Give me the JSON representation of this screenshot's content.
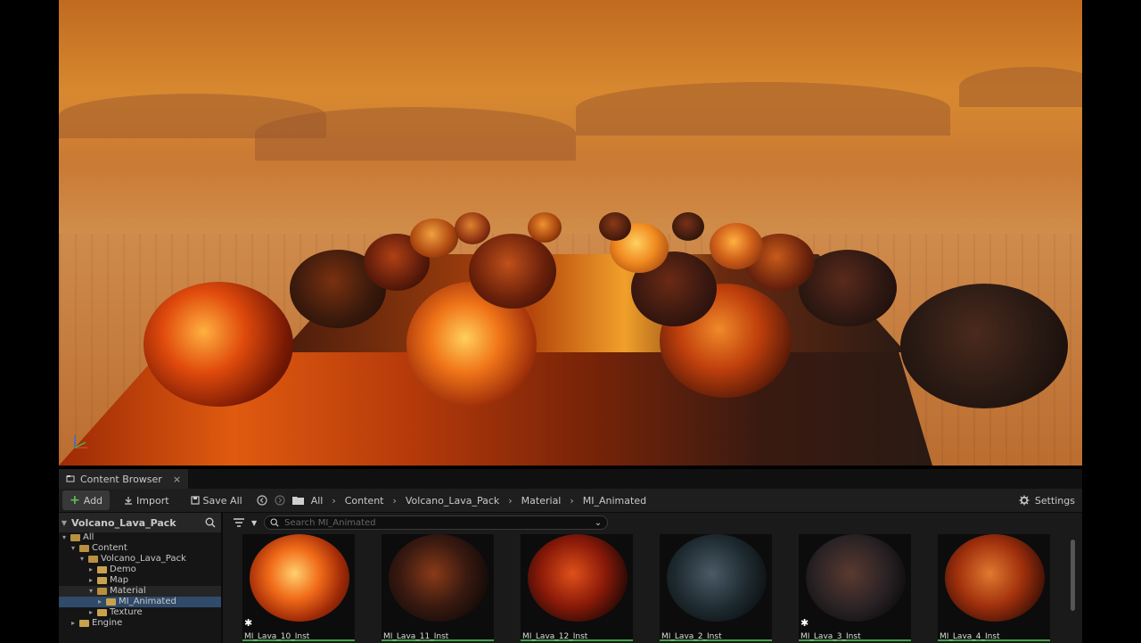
{
  "content_browser": {
    "tab_title": "Content Browser",
    "tab_close": "×",
    "toolbar": {
      "add_label": "Add",
      "import_label": "Import",
      "save_all_label": "Save All",
      "settings_label": "Settings"
    },
    "breadcrumb": [
      "All",
      "Content",
      "Volcano_Lava_Pack",
      "Material",
      "MI_Animated"
    ],
    "tree": {
      "title": "Volcano_Lava_Pack",
      "items": [
        {
          "label": "All",
          "depth": 0,
          "open": true
        },
        {
          "label": "Content",
          "depth": 1,
          "open": true
        },
        {
          "label": "Volcano_Lava_Pack",
          "depth": 2,
          "open": true
        },
        {
          "label": "Demo",
          "depth": 3,
          "open": false
        },
        {
          "label": "Map",
          "depth": 3,
          "open": false
        },
        {
          "label": "Material",
          "depth": 3,
          "open": true
        },
        {
          "label": "MI_Animated",
          "depth": 4,
          "open": false,
          "selected": true
        },
        {
          "label": "Texture",
          "depth": 3,
          "open": false
        },
        {
          "label": "Engine",
          "depth": 1,
          "open": false
        }
      ]
    },
    "search_placeholder": "Search MI_Animated",
    "assets": [
      {
        "name": "MI_Lava_10_Inst",
        "tone": "bright",
        "starred": true
      },
      {
        "name": "MI_Lava_11_Inst",
        "tone": "dark",
        "starred": false
      },
      {
        "name": "MI_Lava_12_Inst",
        "tone": "red",
        "starred": false
      },
      {
        "name": "MI_Lava_2_Inst",
        "tone": "cool",
        "starred": false
      },
      {
        "name": "MI_Lava_3_Inst",
        "tone": "darkcool",
        "starred": true
      },
      {
        "name": "MI_Lava_4_Inst",
        "tone": "orange",
        "starred": false
      }
    ]
  },
  "colors": {
    "accent_green": "#5bc15b",
    "selection": "#2f4a6a",
    "folder": "#c9a24e"
  }
}
